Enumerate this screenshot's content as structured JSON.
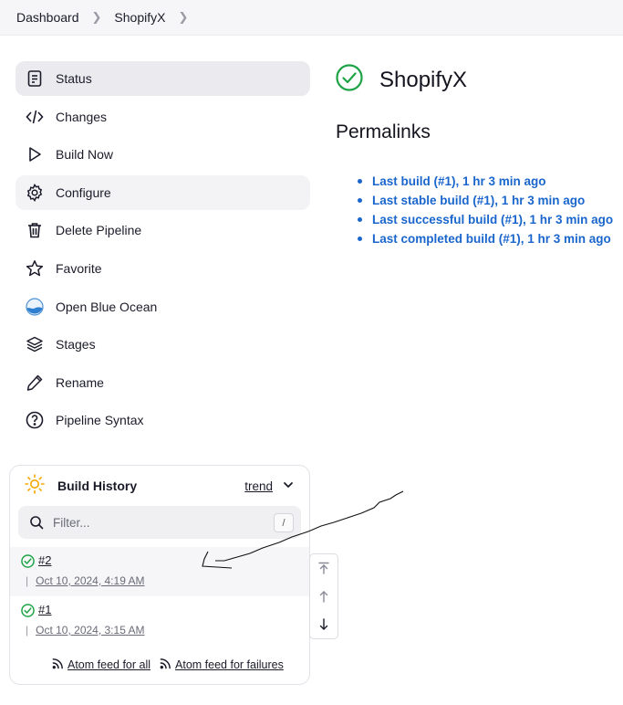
{
  "breadcrumb": {
    "items": [
      "Dashboard",
      "ShopifyX"
    ]
  },
  "sidebar": {
    "items": [
      {
        "label": "Status",
        "icon": "document-icon"
      },
      {
        "label": "Changes",
        "icon": "code-icon"
      },
      {
        "label": "Build Now",
        "icon": "play-icon"
      },
      {
        "label": "Configure",
        "icon": "gear-icon"
      },
      {
        "label": "Delete Pipeline",
        "icon": "trash-icon"
      },
      {
        "label": "Favorite",
        "icon": "star-icon"
      },
      {
        "label": "Open Blue Ocean",
        "icon": "blue-ocean-icon"
      },
      {
        "label": "Stages",
        "icon": "layers-icon"
      },
      {
        "label": "Rename",
        "icon": "pencil-icon"
      },
      {
        "label": "Pipeline Syntax",
        "icon": "help-circle-icon"
      }
    ]
  },
  "main": {
    "title": "ShopifyX",
    "permalinks_heading": "Permalinks",
    "permalinks": [
      "Last build (#1), 1 hr 3 min ago",
      "Last stable build (#1), 1 hr 3 min ago",
      "Last successful build (#1), 1 hr 3 min ago",
      "Last completed build (#1), 1 hr 3 min ago"
    ]
  },
  "build_history": {
    "title": "Build History",
    "trend_label": "trend",
    "filter_placeholder": "Filter...",
    "filter_shortcut": "/",
    "builds": [
      {
        "number": "#2",
        "time": "Oct 10, 2024, 4:19 AM",
        "status": "success"
      },
      {
        "number": "#1",
        "time": "Oct 10, 2024, 3:15 AM",
        "status": "success"
      }
    ],
    "feed_all": "Atom feed for all",
    "feed_failures": "Atom feed for failures"
  },
  "colors": {
    "link": "#1a66cc",
    "success": "#1ea446",
    "sun": "#f2a900"
  }
}
